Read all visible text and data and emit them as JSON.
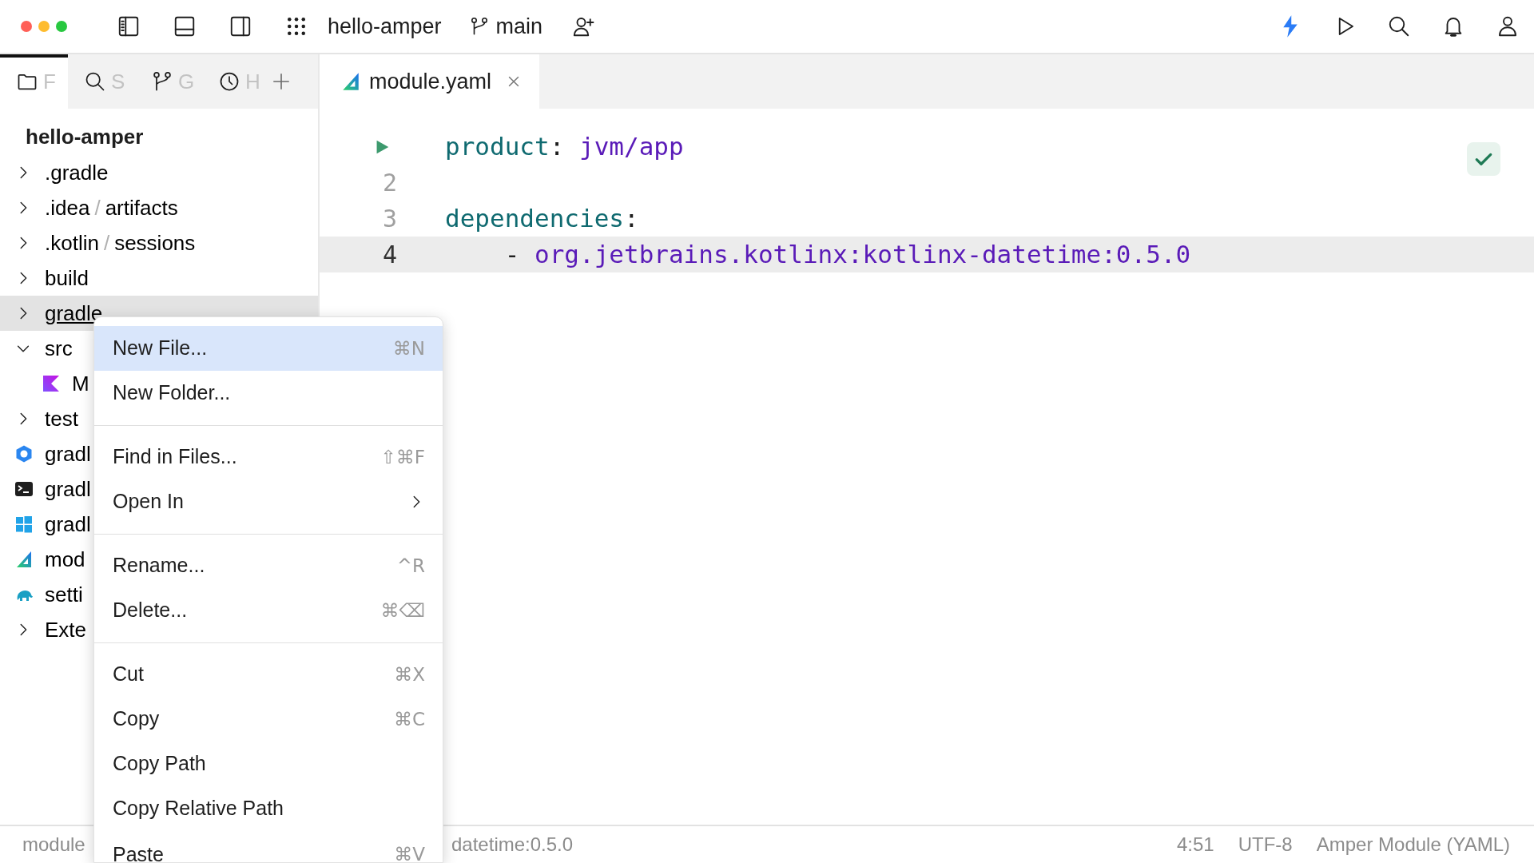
{
  "title_bar": {
    "project": "hello-amper",
    "branch": "main"
  },
  "tool_tabs": [
    {
      "kind": "folder",
      "label": "F",
      "selected": true
    },
    {
      "kind": "search",
      "label": "S",
      "selected": false
    },
    {
      "kind": "branch",
      "label": "G",
      "selected": false
    },
    {
      "kind": "clock",
      "label": "H",
      "selected": false
    }
  ],
  "editor_tabs": [
    {
      "label": "module.yaml",
      "selected": true
    }
  ],
  "project": {
    "title": "hello-amper",
    "items": [
      {
        "kind": "folder",
        "label": ".gradle",
        "expanded": false,
        "selected": false,
        "hovered": false
      },
      {
        "kind": "folder",
        "label": ".idea",
        "separator": "/",
        "sub": "artifacts",
        "expanded": false,
        "selected": false,
        "hovered": false
      },
      {
        "kind": "folder",
        "label": ".kotlin",
        "separator": "/",
        "sub": "sessions",
        "expanded": false,
        "selected": false,
        "hovered": false
      },
      {
        "kind": "folder",
        "label": "build",
        "expanded": false,
        "selected": false,
        "hovered": false
      },
      {
        "kind": "folder",
        "label": "gradle",
        "expanded": false,
        "selected": true,
        "hovered": true
      },
      {
        "kind": "folder",
        "label": "src",
        "expanded": true,
        "selected": false,
        "hovered": false,
        "children": [
          {
            "kind": "kotlin",
            "label": "M",
            "selected": false,
            "hovered": false
          }
        ]
      },
      {
        "kind": "folder",
        "label": "test",
        "expanded": false,
        "selected": false,
        "hovered": false
      },
      {
        "kind": "gradle",
        "label": "gradl",
        "selected": false,
        "hovered": false
      },
      {
        "kind": "terminal",
        "label": "gradl",
        "selected": false,
        "hovered": false
      },
      {
        "kind": "windows",
        "label": "gradl",
        "selected": false,
        "hovered": false
      },
      {
        "kind": "amper",
        "label": "mod",
        "selected": false,
        "hovered": false
      },
      {
        "kind": "elephant",
        "label": "setti",
        "selected": false,
        "hovered": false
      },
      {
        "kind": "folder",
        "label": "Exte",
        "expanded": false,
        "selected": false,
        "hovered": false
      }
    ]
  },
  "editor": {
    "lines": [
      {
        "kind": "run",
        "current": false,
        "tokens": [
          {
            "kind": "key",
            "text": "product"
          },
          {
            "kind": "punct",
            "text": ": "
          },
          {
            "kind": "value",
            "text": "jvm/app"
          }
        ]
      },
      {
        "kind": "number",
        "number": "2",
        "current": false
      },
      {
        "kind": "number",
        "number": "3",
        "current": false,
        "tokens": [
          {
            "kind": "key",
            "text": "dependencies"
          },
          {
            "kind": "punct",
            "text": ":"
          }
        ]
      },
      {
        "kind": "number",
        "number": "4",
        "current": true,
        "tokens": [
          {
            "kind": "punct",
            "text": "    - "
          },
          {
            "kind": "value",
            "text": "org.jetbrains.kotlinx:kotlinx-datetime:0.5.0"
          }
        ]
      }
    ]
  },
  "context_menu": {
    "items": [
      {
        "kind": "item",
        "label": "New File...",
        "shortcut": "⌘N",
        "submenu": false,
        "selected": true
      },
      {
        "kind": "item",
        "label": "New Folder...",
        "submenu": false,
        "selected": false
      },
      {
        "kind": "separator"
      },
      {
        "kind": "item",
        "label": "Find in Files...",
        "shortcut": "⇧⌘F",
        "submenu": false,
        "selected": false
      },
      {
        "kind": "item",
        "label": "Open In",
        "submenu": true,
        "selected": false
      },
      {
        "kind": "separator"
      },
      {
        "kind": "item",
        "label": "Rename...",
        "shortcut": "^R",
        "submenu": false,
        "selected": false
      },
      {
        "kind": "item",
        "label": "Delete...",
        "shortcut": "⌘⌫",
        "submenu": false,
        "selected": false
      },
      {
        "kind": "separator"
      },
      {
        "kind": "item",
        "label": "Cut",
        "shortcut": "⌘X",
        "submenu": false,
        "selected": false
      },
      {
        "kind": "item",
        "label": "Copy",
        "shortcut": "⌘C",
        "submenu": false,
        "selected": false
      },
      {
        "kind": "item",
        "label": "Copy Path",
        "submenu": false,
        "selected": false
      },
      {
        "kind": "item",
        "label": "Copy Relative Path",
        "submenu": false,
        "selected": false
      },
      {
        "kind": "item",
        "label": "Paste",
        "shortcut": "⌘V",
        "submenu": false,
        "selected": false
      }
    ]
  },
  "status_bar": {
    "left": [
      "module",
      "datetime:0.5.0"
    ],
    "right": [
      "4:51",
      "UTF-8",
      "Amper Module (YAML)"
    ]
  }
}
